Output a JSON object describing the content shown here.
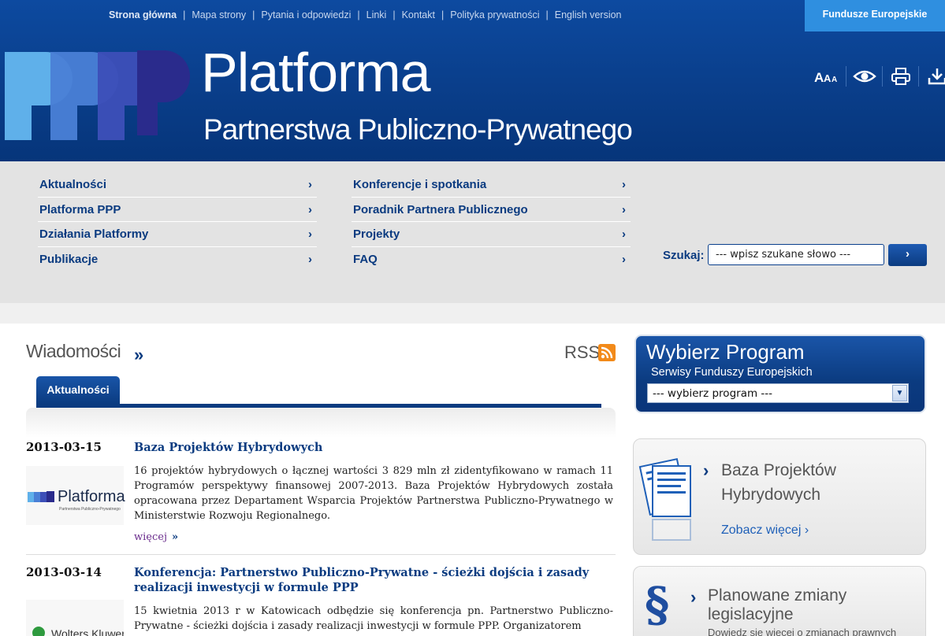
{
  "topnav": {
    "items": [
      "Strona główna",
      "Mapa strony",
      "Pytania i odpowiedzi",
      "Linki",
      "Kontakt",
      "Polityka prywatności",
      "English version"
    ],
    "fundusze_label": "Fundusze Europejskie"
  },
  "brand": {
    "title": "Platforma",
    "subtitle": "Partnerstwa Publiczno-Prywatnego",
    "colors": {
      "header": "#0a3f8c",
      "logo_light": "#5fb0ea",
      "logo_dark": "#2a2b8c"
    }
  },
  "tools": [
    "font-size-icon",
    "contrast-eye-icon",
    "print-icon",
    "download-icon"
  ],
  "menu": {
    "left": [
      "Aktualności",
      "Platforma PPP",
      "Działania Platformy",
      "Publikacje"
    ],
    "right": [
      "Konferencje i spotkania",
      "Poradnik Partnera Publicznego",
      "Projekty",
      "FAQ"
    ],
    "arrow": "›"
  },
  "search": {
    "label": "Szukaj:",
    "value": "--- wpisz szukane słowo ---",
    "button": "›"
  },
  "news": {
    "title": "Wiadomości",
    "arrow": "»",
    "rss": "RSS",
    "tab": "Aktualności",
    "items": [
      {
        "date": "2013-03-15",
        "title": "Baza Projektów Hybrydowych",
        "body": "16 projektów hybrydowych o łącznej wartości 3 829 mln zł zidentyfikowano w ramach 11 Programów perspektywy finansowej 2007-2013. Baza Projektów Hybrydowych została opracowana przez Departament Wsparcia Projektów Partnerstwa Publiczno-Prywatnego w Ministerstwie Rozwoju Regionalnego.",
        "more": "więcej",
        "more_arrow": "»",
        "thumb_text": "Platforma",
        "thumb_sub": "Partnerstwa Publiczno-Prywatnego"
      },
      {
        "date": "2013-03-14",
        "title": "Konferencja: Partnerstwo Publiczno-Prywatne - ścieżki dojścia i zasady realizacji inwestycji w formule PPP",
        "body": "15 kwietnia 2013 r w Katowicach odbędzie się konferencja pn. Partnerstwo Publiczno-Prywatne - ścieżki dojścia i zasady realizacji inwestycji w formule PPP. Organizatorem",
        "thumb_text": "Wolters Kluwer"
      }
    ]
  },
  "program": {
    "title": "Wybierz Program",
    "subtitle": "Serwisy Funduszy Europejskich",
    "select_value": "--- wybierz program ---"
  },
  "cards": [
    {
      "title_line1": "Baza Projektów",
      "title_line2": "Hybrydowych",
      "link": "Zobacz więcej",
      "link_arrow": "›",
      "chev": "›"
    },
    {
      "title_line1": "Planowane zmiany",
      "title_line2": "legislacyjne",
      "sub": "Dowiedz się więcej o zmianach prawnych",
      "chev": "›",
      "icon": "§"
    }
  ]
}
